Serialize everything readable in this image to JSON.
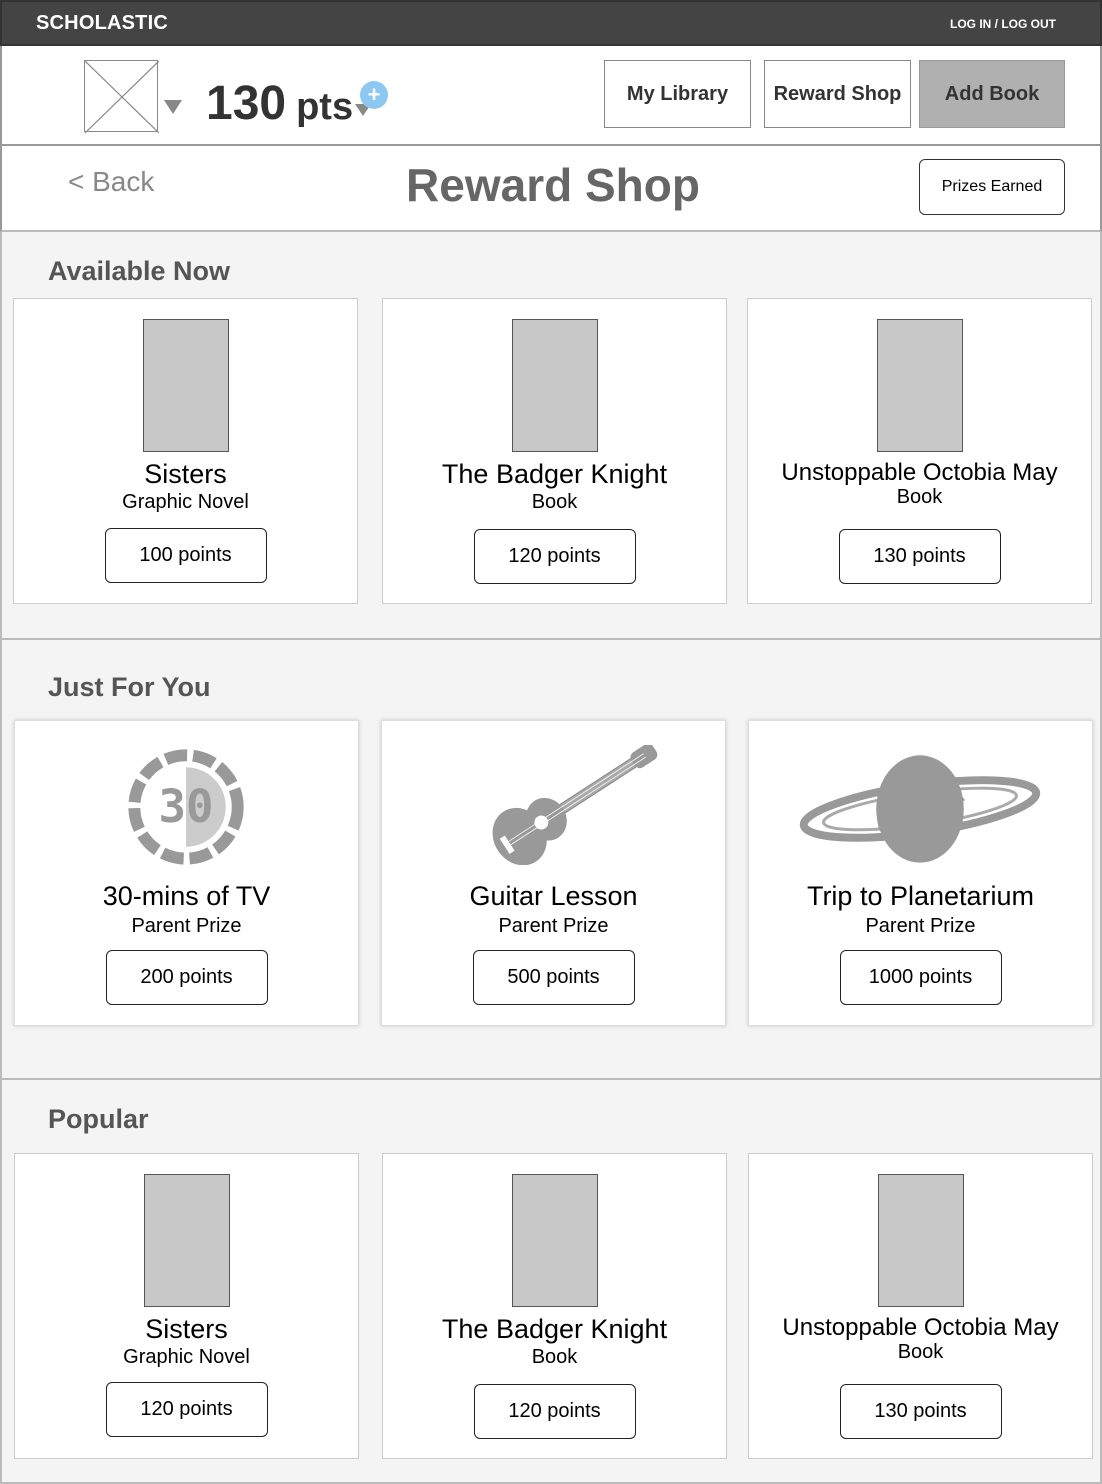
{
  "topbar": {
    "brand": "SCHOLASTIC",
    "login": "LOG IN / LOG OUT"
  },
  "header": {
    "points_value": "130",
    "points_unit": "pts",
    "plus_icon": "+",
    "nav": {
      "my_library": "My Library",
      "reward_shop": "Reward Shop",
      "add_book": "Add Book"
    }
  },
  "titlebar": {
    "back": "< Back",
    "title": "Reward Shop",
    "prizes_earned": "Prizes Earned"
  },
  "sections": {
    "available": {
      "title": "Available Now",
      "items": [
        {
          "name": "Sisters",
          "type": "Graphic Novel",
          "points": "100 points"
        },
        {
          "name": "The Badger Knight",
          "type": "Book",
          "points": "120 points"
        },
        {
          "name": "Unstoppable Octobia May",
          "type": "Book",
          "points": "130 points"
        }
      ]
    },
    "just_for_you": {
      "title": "Just For You",
      "items": [
        {
          "name": "30-mins of TV",
          "type": "Parent Prize",
          "points": "200 points",
          "icon": "timer-30-icon"
        },
        {
          "name": "Guitar Lesson",
          "type": "Parent Prize",
          "points": "500 points",
          "icon": "guitar-icon"
        },
        {
          "name": "Trip to Planetarium",
          "type": "Parent Prize",
          "points": "1000 points",
          "icon": "planet-icon"
        }
      ]
    },
    "popular": {
      "title": "Popular",
      "items": [
        {
          "name": "Sisters",
          "type": "Graphic Novel",
          "points": "120 points"
        },
        {
          "name": "The Badger Knight",
          "type": "Book",
          "points": "120 points"
        },
        {
          "name": "Unstoppable Octobia May",
          "type": "Book",
          "points": "130 points"
        }
      ]
    }
  },
  "colors": {
    "topbar": "#444444",
    "plus_accent": "#8dc8f2",
    "section_bg": "#f4f4f4",
    "cover_gray": "#c8c8c8"
  }
}
